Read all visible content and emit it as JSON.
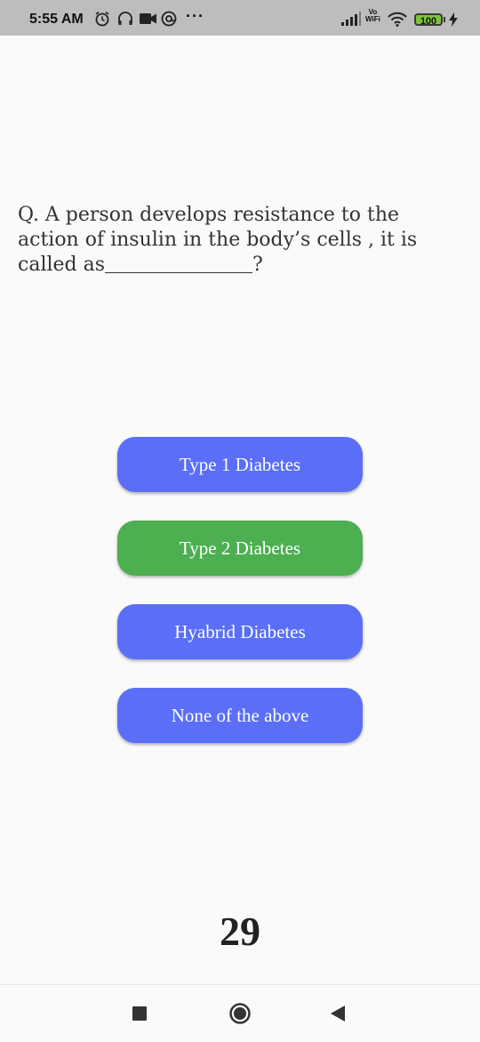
{
  "status_bar": {
    "time": "5:55 AM",
    "network_label_top": "Vo",
    "network_label_bottom": "WiFi",
    "battery_level": "100",
    "icons": [
      "alarm-icon",
      "headphones-icon",
      "video-camera-icon",
      "at-sign-icon",
      "more-dots-icon",
      "signal-icon",
      "wifi-icon",
      "battery-icon",
      "charging-bolt-icon"
    ]
  },
  "quiz": {
    "question_prefix": "Q. A person develops resistance to the action of insulin in the body’s cells , it is called as",
    "question_suffix": "?",
    "options": [
      {
        "label": "Type 1 Diabetes",
        "color": "#5a6ef8"
      },
      {
        "label": "Type 2 Diabetes",
        "color": "#4caf50"
      },
      {
        "label": "Hyabrid Diabetes",
        "color": "#5a6ef8"
      },
      {
        "label": "None of the above",
        "color": "#5a6ef8"
      }
    ],
    "selected_option": "Type 2 Diabetes",
    "timer": "29"
  },
  "nav_bar": {
    "icons": [
      "recents-square-icon",
      "home-circle-icon",
      "back-triangle-icon"
    ]
  }
}
